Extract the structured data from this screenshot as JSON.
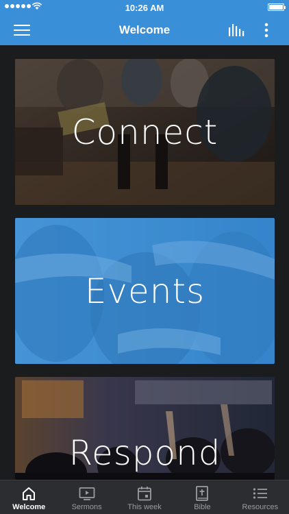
{
  "status_bar": {
    "time": "10:26 AM"
  },
  "header": {
    "title": "Welcome",
    "menu_icon": "hamburger-icon",
    "stats_icon": "bar-chart-icon",
    "more_icon": "more-vertical-icon"
  },
  "cards": [
    {
      "label": "Connect"
    },
    {
      "label": "Events"
    },
    {
      "label": "Respond"
    }
  ],
  "tabs": [
    {
      "label": "Welcome",
      "icon": "home-icon",
      "active": true
    },
    {
      "label": "Sermons",
      "icon": "video-icon",
      "active": false
    },
    {
      "label": "This week",
      "icon": "calendar-icon",
      "active": false
    },
    {
      "label": "Bible",
      "icon": "bible-icon",
      "active": false
    },
    {
      "label": "Resources",
      "icon": "list-icon",
      "active": false
    }
  ],
  "colors": {
    "header": "#3a8fd9",
    "background": "#1b1c1e",
    "tabbar": "#2b2d30",
    "events_tint": "#3a8fd9"
  }
}
